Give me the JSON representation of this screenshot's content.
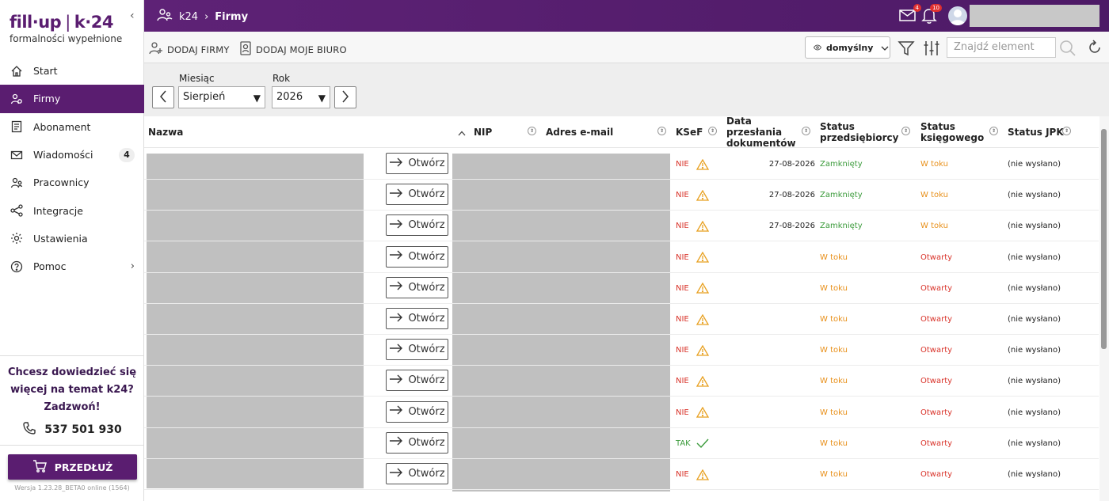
{
  "brand": {
    "logo_a": "fill·up",
    "logo_b": "k·24",
    "tagline": "formalności wypełnione"
  },
  "sidebar": {
    "items": [
      {
        "label": "Start",
        "icon": "home-icon"
      },
      {
        "label": "Firmy",
        "icon": "companies-icon",
        "active": true
      },
      {
        "label": "Abonament",
        "icon": "subscription-icon"
      },
      {
        "label": "Wiadomości",
        "icon": "mail-icon",
        "badge": "4"
      },
      {
        "label": "Pracownicy",
        "icon": "employees-icon"
      },
      {
        "label": "Integracje",
        "icon": "share-icon"
      },
      {
        "label": "Ustawienia",
        "icon": "gear-icon"
      },
      {
        "label": "Pomoc",
        "icon": "help-icon"
      }
    ],
    "promo": "Chcesz dowiedzieć się więcej na temat k24? Zadzwoń!",
    "phone": "537 501 930",
    "renew": "PRZEDŁUŻ",
    "version": "Wersja 1.23.28_BETA0 online (1564)"
  },
  "topbar": {
    "crumb_root": "k24",
    "crumb_current": "Firmy",
    "mail_badge": "4",
    "bell_badge": "10"
  },
  "toolbar": {
    "add_companies": "DODAJ FIRMY",
    "add_office": "DODAJ MOJE BIURO",
    "view": "domyślny",
    "search_placeholder": "Znajdź element"
  },
  "filters": {
    "month_label": "Miesiąc",
    "month": "Sierpień",
    "year_label": "Rok",
    "year": "2026"
  },
  "table": {
    "columns": [
      "Nazwa",
      "NIP",
      "Adres e-mail",
      "KSeF",
      "Data przesłania dokumentów",
      "Status przedsiębiorcy",
      "Status księgowego",
      "Status JPK"
    ],
    "open_label": "Otwórz",
    "rows": [
      {
        "ksef": "NIE",
        "date": "27-08-2026",
        "owner": "Zamknięty",
        "acct": "W toku",
        "jpk": "(nie wysłano)"
      },
      {
        "ksef": "NIE",
        "date": "27-08-2026",
        "owner": "Zamknięty",
        "acct": "W toku",
        "jpk": "(nie wysłano)"
      },
      {
        "ksef": "NIE",
        "date": "27-08-2026",
        "owner": "Zamknięty",
        "acct": "W toku",
        "jpk": "(nie wysłano)"
      },
      {
        "ksef": "NIE",
        "date": "",
        "owner": "W toku",
        "acct": "Otwarty",
        "jpk": "(nie wysłano)"
      },
      {
        "ksef": "NIE",
        "date": "",
        "owner": "W toku",
        "acct": "Otwarty",
        "jpk": "(nie wysłano)"
      },
      {
        "ksef": "NIE",
        "date": "",
        "owner": "W toku",
        "acct": "Otwarty",
        "jpk": "(nie wysłano)"
      },
      {
        "ksef": "NIE",
        "date": "",
        "owner": "W toku",
        "acct": "Otwarty",
        "jpk": "(nie wysłano)"
      },
      {
        "ksef": "NIE",
        "date": "",
        "owner": "W toku",
        "acct": "Otwarty",
        "jpk": "(nie wysłano)"
      },
      {
        "ksef": "NIE",
        "date": "",
        "owner": "W toku",
        "acct": "Otwarty",
        "jpk": "(nie wysłano)"
      },
      {
        "ksef": "TAK",
        "date": "",
        "owner": "W toku",
        "acct": "Otwarty",
        "jpk": "(nie wysłano)"
      },
      {
        "ksef": "NIE",
        "date": "",
        "owner": "W toku",
        "acct": "Otwarty",
        "jpk": "(nie wysłano)"
      }
    ]
  },
  "colors": {
    "brand": "#5a1d70",
    "red": "#d9342b",
    "green": "#3a9a3a",
    "orange": "#e8901a",
    "warn": "#e8a020"
  }
}
